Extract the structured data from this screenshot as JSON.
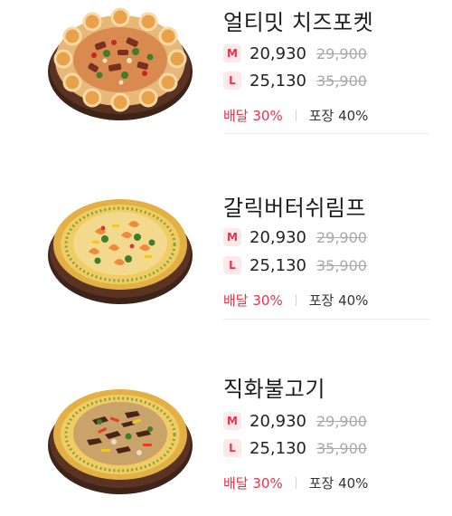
{
  "menu_items": [
    {
      "name": "얼티밋 치즈포켓",
      "sizes": [
        {
          "size": "M",
          "price": "20,930",
          "original_price": "29,900"
        },
        {
          "size": "L",
          "price": "25,130",
          "original_price": "35,900"
        }
      ],
      "delivery_discount": "배달 30%",
      "pickup_discount": "포장 40%"
    },
    {
      "name": "갈릭버터쉬림프",
      "sizes": [
        {
          "size": "M",
          "price": "20,930",
          "original_price": "29,900"
        },
        {
          "size": "L",
          "price": "25,130",
          "original_price": "35,900"
        }
      ],
      "delivery_discount": "배달 30%",
      "pickup_discount": "포장 40%"
    },
    {
      "name": "직화불고기",
      "sizes": [
        {
          "size": "M",
          "price": "20,930",
          "original_price": "29,900"
        },
        {
          "size": "L",
          "price": "25,130",
          "original_price": "35,900"
        }
      ],
      "delivery_discount": "배달 30%",
      "pickup_discount": "포장 40%"
    }
  ],
  "colors": {
    "accent_red": "#e8334a",
    "badge_bg": "#fde8ea",
    "strikethrough_gray": "#a8a8a8"
  }
}
